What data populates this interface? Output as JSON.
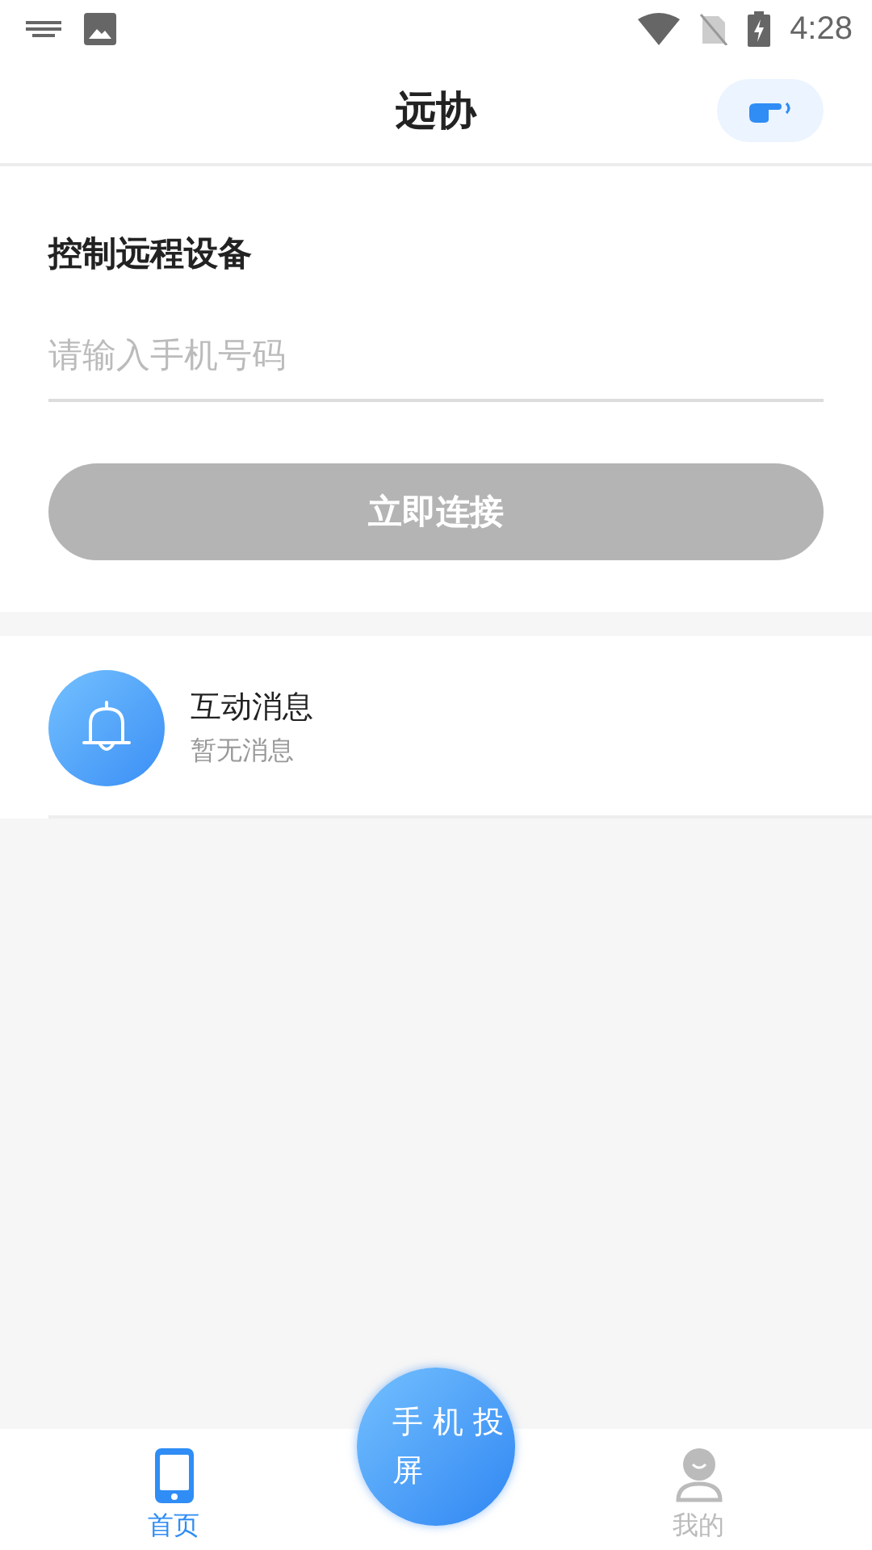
{
  "status_bar": {
    "time": "4:28"
  },
  "header": {
    "title": "远协"
  },
  "remote": {
    "heading": "控制远程设备",
    "phone": {
      "placeholder": "请输入手机号码"
    },
    "connect_button": {
      "label": "立即连接",
      "disabled": true
    }
  },
  "messages": [
    {
      "title": "互动消息",
      "subtitle": "暂无消息"
    }
  ],
  "bottom_nav": {
    "tabs": [
      {
        "kind": "phone",
        "label": "首页",
        "selected": true
      },
      {
        "kind": "user",
        "label": "我的",
        "selected": false
      }
    ],
    "center_button": {
      "label": "手机投屏"
    }
  }
}
